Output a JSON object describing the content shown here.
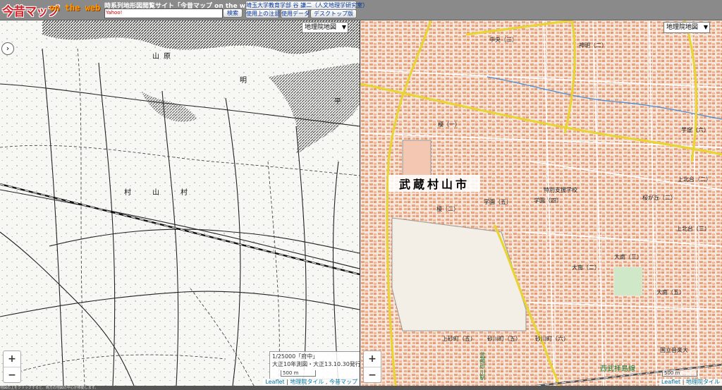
{
  "header": {
    "logo_main": "今昔マップ",
    "logo_sub": "on the web",
    "site_title": "時系列地形図閲覧サイト「今昔マップ on the web」",
    "search_badge": "Yahoo!",
    "search_value": "",
    "search_button": "検索",
    "links": [
      "埼玉大学教育学部 谷 謙二（人文地理学研究室）",
      "使用上の注意",
      "使用データ",
      "デスクトップ版"
    ]
  },
  "left_map": {
    "layer_select": "地理院地図",
    "labels": [
      "村",
      "山",
      "村",
      "山",
      "原",
      "平",
      "明"
    ],
    "info_lines": [
      "1/25000「府中」",
      "大正10年測図・大正13.10.30発行"
    ],
    "scale": "500 m",
    "zoom_in": "+",
    "zoom_out": "−",
    "attribution": [
      "Leaflet",
      "地理院タイル",
      "今昔マップ"
    ]
  },
  "right_map": {
    "layer_select": "地理院地図",
    "city_name": "武蔵村山市",
    "district_labels": [
      "中央（三）",
      "神明（二）",
      "学園（五）",
      "学園（四）",
      "大南（二）",
      "大南（三）",
      "大南（五）",
      "砂川町（五）",
      "砂川町（六）",
      "上砂町（五）",
      "榎（一）",
      "榎（二）",
      "上北台（二）",
      "上北台（三）",
      "桜が丘（二）",
      "芋窪（六）",
      "特別支援学校",
      "国立音楽大"
    ],
    "station": "武蔵砂川駅",
    "railway": "西武拝島線",
    "scale": "500 m",
    "zoom_in": "+",
    "zoom_out": "−",
    "attribution": [
      "Leaflet",
      "地理院タイル"
    ]
  },
  "footer_text": "地図の上をクリックすると、両方の地図の中心が移動します。"
}
